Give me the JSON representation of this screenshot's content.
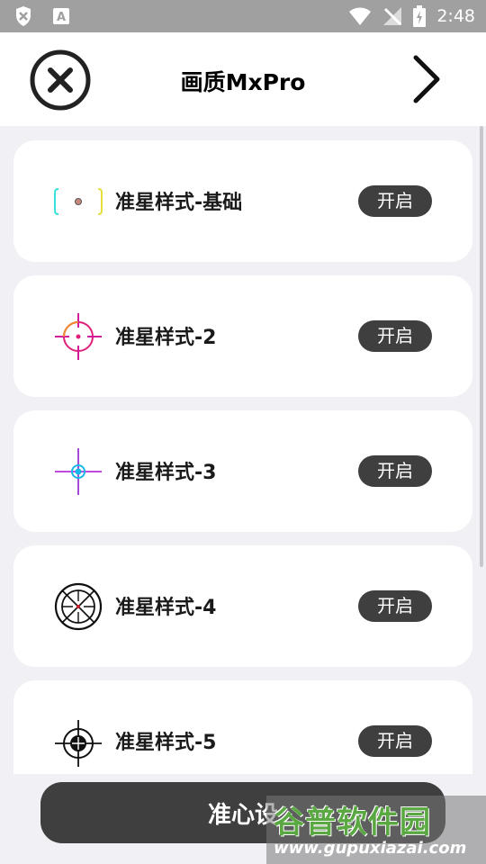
{
  "status_bar": {
    "time": "2:48",
    "icons": [
      "shield-icon",
      "font-a-icon",
      "wifi-icon",
      "no-signal-icon",
      "battery-charging-icon"
    ]
  },
  "header": {
    "title": "画质MxPro",
    "close_icon": "close-circle-icon",
    "next_icon": "chevron-right-icon"
  },
  "crosshair_list": [
    {
      "label": "准星样式-基础",
      "button": "开启",
      "icon": "crosshair-basic-icon"
    },
    {
      "label": "准星样式-2",
      "button": "开启",
      "icon": "crosshair-pink-icon"
    },
    {
      "label": "准星样式-3",
      "button": "开启",
      "icon": "crosshair-cyan-icon"
    },
    {
      "label": "准星样式-4",
      "button": "开启",
      "icon": "crosshair-scope-icon"
    },
    {
      "label": "准星样式-5",
      "button": "开启",
      "icon": "crosshair-target-icon"
    }
  ],
  "bottom_button": {
    "label": "准心设"
  },
  "watermark": {
    "name": "谷普软件园",
    "url": "www.gupuxiazai.com"
  },
  "colors": {
    "accent": "#3f3f3f",
    "background": "#f1f1f5",
    "statusbar": "#a0a0a0",
    "watermark_green": "#5aa842"
  }
}
